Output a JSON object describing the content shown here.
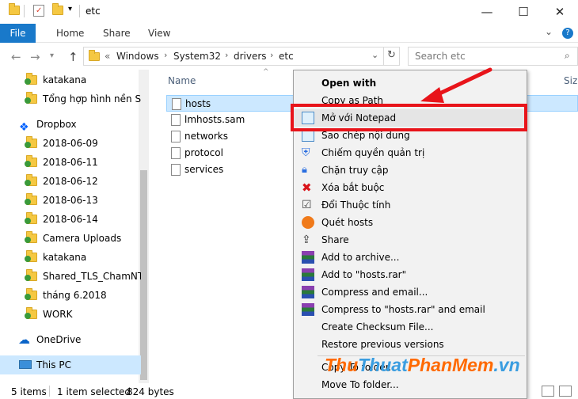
{
  "window": {
    "title": "etc",
    "minimize": "—",
    "maximize": "☐",
    "close": "✕"
  },
  "ribbon": {
    "tabs": [
      "File",
      "Home",
      "Share",
      "View"
    ],
    "expand": "⌄",
    "help": "?"
  },
  "address": {
    "prefix": "«",
    "crumbs": [
      "Windows",
      "System32",
      "drivers",
      "etc"
    ],
    "search_placeholder": "Search etc"
  },
  "nav": {
    "items": [
      {
        "label": "katakana",
        "type": "folder-check"
      },
      {
        "label": "Tổng hợp hình nền Slic",
        "type": "folder-check"
      },
      {
        "label": "Dropbox",
        "type": "dropbox"
      },
      {
        "label": "2018-06-09",
        "type": "folder-check"
      },
      {
        "label": "2018-06-11",
        "type": "folder-check"
      },
      {
        "label": "2018-06-12",
        "type": "folder-check"
      },
      {
        "label": "2018-06-13",
        "type": "folder-check"
      },
      {
        "label": "2018-06-14",
        "type": "folder-check"
      },
      {
        "label": "Camera Uploads",
        "type": "folder-check"
      },
      {
        "label": "katakana",
        "type": "folder-check"
      },
      {
        "label": "Shared_TLS_ChamNT",
        "type": "folder-shared"
      },
      {
        "label": "tháng 6.2018",
        "type": "folder-check"
      },
      {
        "label": "WORK",
        "type": "folder-check"
      },
      {
        "label": "OneDrive",
        "type": "onedrive"
      },
      {
        "label": "This PC",
        "type": "pc"
      }
    ]
  },
  "files": {
    "column_name": "Name",
    "column_size": "Size",
    "items": [
      "hosts",
      "lmhosts.sam",
      "networks",
      "protocol",
      "services"
    ]
  },
  "status": {
    "count": "5 items",
    "selection": "1 item selected",
    "size": "824 bytes"
  },
  "context_menu": {
    "items": [
      "Open with",
      "Copy as Path",
      "Mở với Notepad",
      "Sao chép nội dung",
      "Chiếm quyền quản trị",
      "Chặn truy cập",
      "Xóa bắt buộc",
      "Đổi Thuộc tính",
      "Quét hosts",
      "Share",
      "Add to archive...",
      "Add to \"hosts.rar\"",
      "Compress and email...",
      "Compress to \"hosts.rar\" and email",
      "Create Checksum File...",
      "Restore previous versions",
      "Copy To folder...",
      "Move To folder..."
    ]
  },
  "watermark": {
    "part1": "Thu",
    "part2": "Thuat",
    "part3": "PhanMem",
    "part4": ".vn"
  },
  "colors": {
    "accent": "#1979ca",
    "highlight_red": "#e8141a",
    "selection": "#cce8ff"
  }
}
